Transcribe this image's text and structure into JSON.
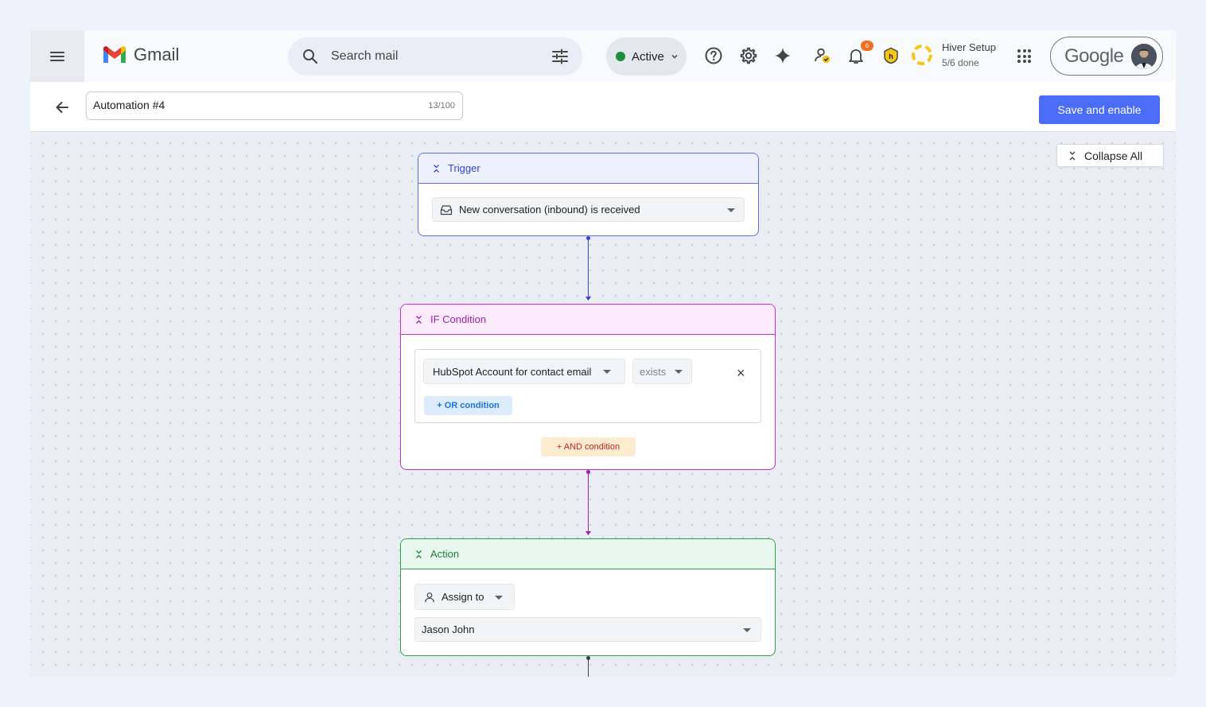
{
  "header": {
    "app_name": "Gmail",
    "search_placeholder": "Search mail",
    "status_label": "Active",
    "notification_count": "6",
    "hiver_setup_title": "Hiver Setup",
    "hiver_setup_progress": "5/6 done",
    "account_brand": "Google",
    "colors": {
      "gmail_red": "#ea4335",
      "status_green": "#1e8e3e",
      "badge_orange": "#f26d21"
    }
  },
  "automation": {
    "name": "Automation #4",
    "char_count": "13/100",
    "save_label": "Save and enable",
    "collapse_all_label": "Collapse All"
  },
  "trigger": {
    "title": "Trigger",
    "event": "New conversation (inbound) is received",
    "color": "#5d6ee8"
  },
  "condition": {
    "title": "IF Condition",
    "field": "HubSpot Account for contact email",
    "operator": "exists",
    "or_label": "+ OR condition",
    "and_label": "+ AND condition",
    "color": "#c42ed4"
  },
  "action": {
    "title": "Action",
    "type": "Assign to",
    "assignee": "Jason John",
    "color": "#2e9e49"
  }
}
